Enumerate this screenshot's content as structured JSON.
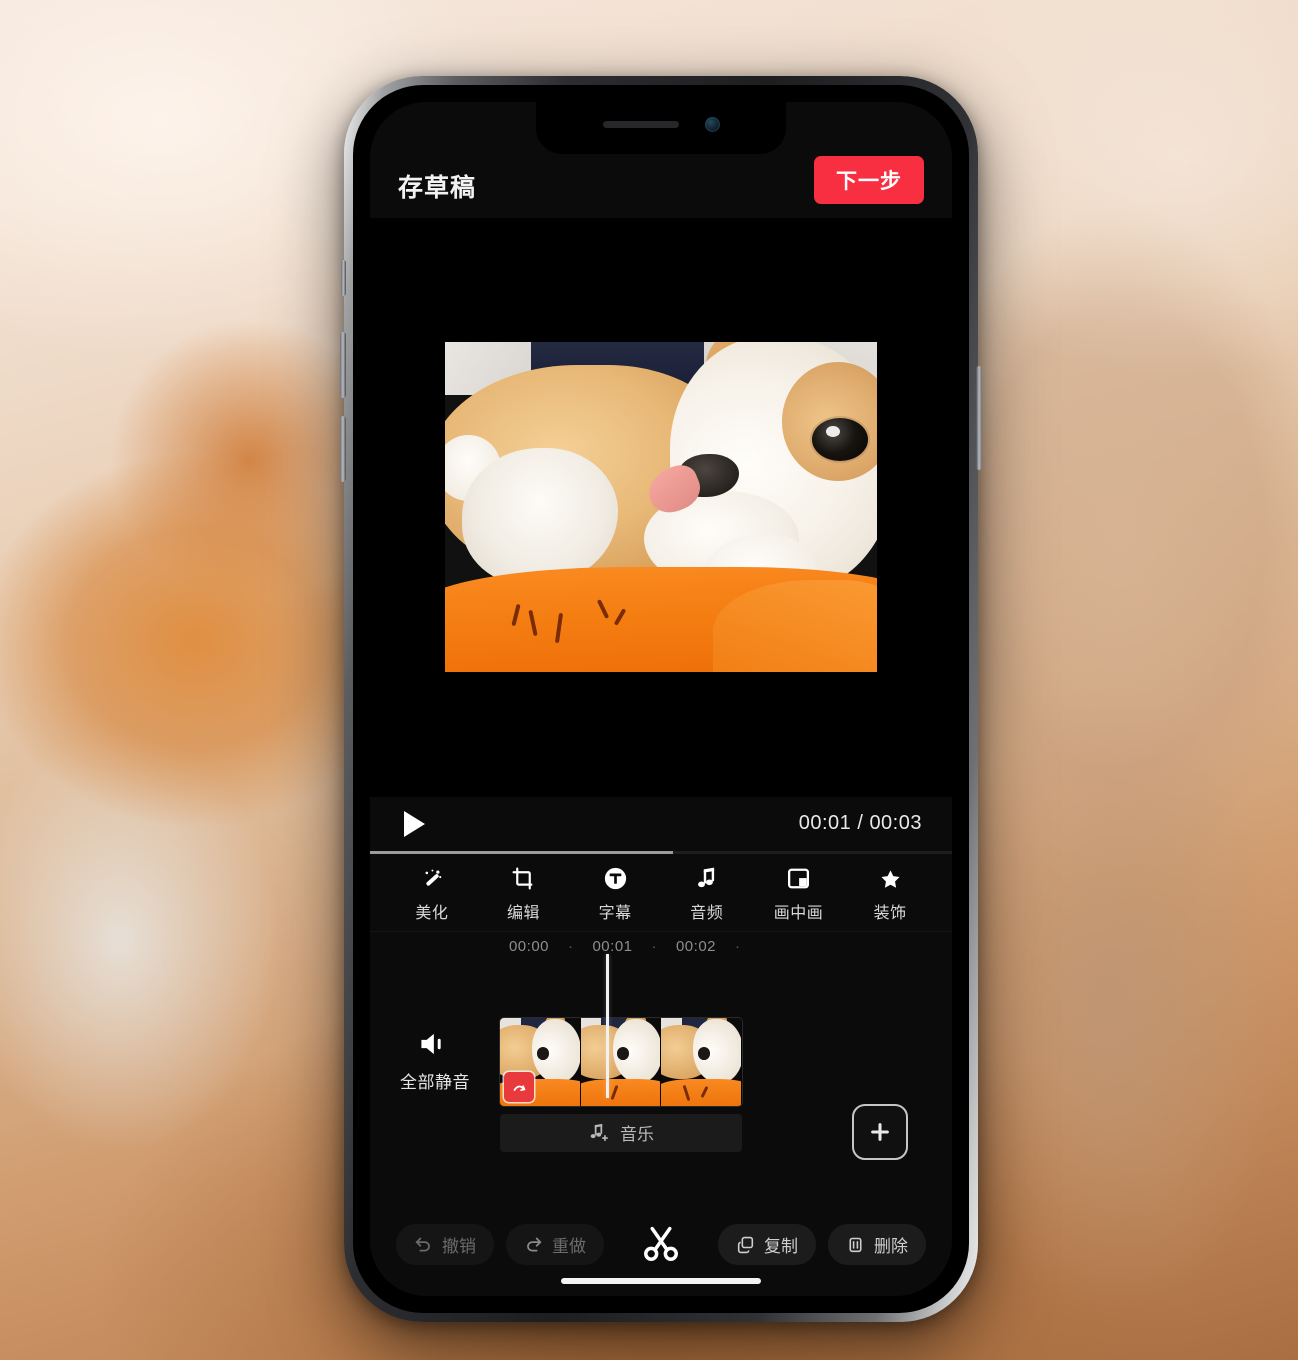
{
  "app": {
    "name": "video-editor",
    "accent_color": "#f72f40",
    "background_color": "#0b0b0b"
  },
  "topbar": {
    "save_draft_label": "存草稿",
    "next_label": "下一步"
  },
  "preview": {
    "description": "两只柯基犬躺在橙色毯子上",
    "aspect": "4:3"
  },
  "transport": {
    "play_icon": "play-icon",
    "current_time": "00:01",
    "total_time": "00:03",
    "time_display": "00:01 / 00:03",
    "progress_percent": 52
  },
  "toolbar": {
    "items": [
      {
        "label": "美化",
        "icon": "magic-wand-icon"
      },
      {
        "label": "编辑",
        "icon": "crop-icon"
      },
      {
        "label": "字幕",
        "icon": "text-circle-icon"
      },
      {
        "label": "音频",
        "icon": "music-note-icon"
      },
      {
        "label": "画中画",
        "icon": "picture-in-picture-icon"
      },
      {
        "label": "装饰",
        "icon": "star-icon"
      }
    ]
  },
  "timeline": {
    "ruler_ticks": [
      "00:00",
      "00:01",
      "00:02"
    ],
    "tick_separator": "·",
    "mute_all_label": "全部静音",
    "mute_all_icon": "speaker-mute-icon",
    "music_label": "音乐",
    "music_icon": "add-music-icon",
    "add_clip_icon": "plus-icon",
    "clip_thumbnail_count": 3,
    "clip_badge_icon": "effect-badge-icon",
    "playhead_position_percent": 52
  },
  "bottombar": {
    "undo_label": "撤销",
    "undo_icon": "undo-arrow-icon",
    "redo_label": "重做",
    "redo_icon": "redo-arrow-icon",
    "split_icon": "scissors-icon",
    "copy_label": "复制",
    "copy_icon": "copy-icon",
    "delete_label": "删除",
    "delete_icon": "trash-icon"
  },
  "device": {
    "type": "iphone-x",
    "notch_elements": [
      "speaker-grille",
      "front-camera"
    ],
    "home_indicator": true
  }
}
